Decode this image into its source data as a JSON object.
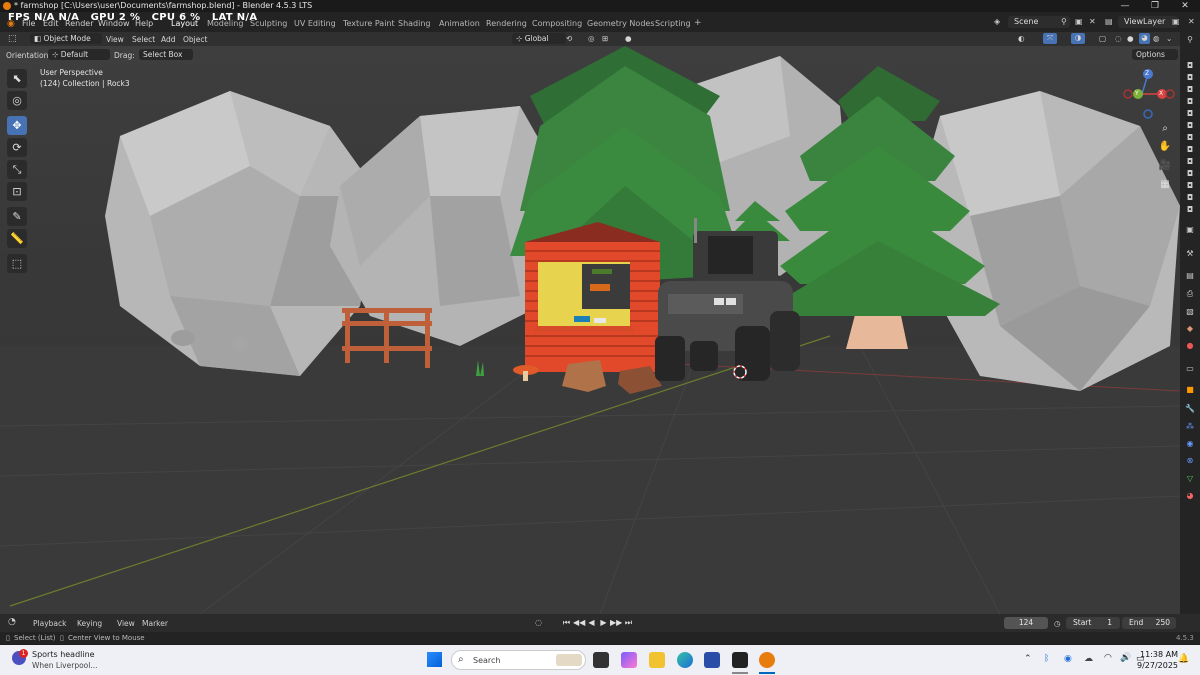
{
  "window": {
    "title": "* farmshop [C:\\Users\\user\\Documents\\farmshop.blend] - Blender 4.5.3 LTS",
    "minimize": "—",
    "maximize": "❐",
    "close": "✕"
  },
  "perf": {
    "fps_label": "FPS",
    "fps_value": "N/A",
    "fps_value2": "N/A",
    "gpu_label": "GPU",
    "gpu_value": "2 %",
    "cpu_label": "CPU",
    "cpu_value": "6 %",
    "lat_label": "LAT",
    "lat_value": "N/A"
  },
  "menu": [
    "File",
    "Edit",
    "Render",
    "Window",
    "Help"
  ],
  "workspaces": [
    "Layout",
    "Modeling",
    "Sculpting",
    "UV Editing",
    "Texture Paint",
    "Shading",
    "Animation",
    "Rendering",
    "Compositing",
    "Geometry Nodes",
    "Scripting"
  ],
  "workspace_add": "+",
  "scene": {
    "name": "Scene",
    "viewlayer": "ViewLayer"
  },
  "viewport_header": {
    "mode": "Object Mode",
    "menus": [
      "View",
      "Select",
      "Add",
      "Object"
    ],
    "transform": "Global"
  },
  "tool_header": {
    "orientation_label": "Orientation:",
    "orientation_value": "Default",
    "drag_label": "Drag:",
    "drag_value": "Select Box",
    "options": "Options"
  },
  "viewport": {
    "perspective": "User Perspective",
    "collection": "(124) Collection | Rock3"
  },
  "gizmo": {
    "y": "Y",
    "x": "X",
    "z": "Z"
  },
  "timeline": {
    "menus": [
      "Playback",
      "Keying",
      "View",
      "Marker"
    ],
    "current_frame": "124",
    "start_label": "Start",
    "start_value": "1",
    "end_label": "End",
    "end_value": "250"
  },
  "statusbar": {
    "left1": "Select (List)",
    "left2": "Center View to Mouse",
    "version": "4.5.3"
  },
  "taskbar": {
    "news_title": "Sports headline",
    "news_sub": "When Liverpool...",
    "news_badge": "1",
    "search_placeholder": "Search",
    "time": "11:38 AM",
    "date": "9/27/2025"
  },
  "colors": {
    "accent": "#4772b3",
    "shop_red": "#e04a2a",
    "tree_green": "#3f8a3f",
    "rock": "#bdbdbd"
  }
}
